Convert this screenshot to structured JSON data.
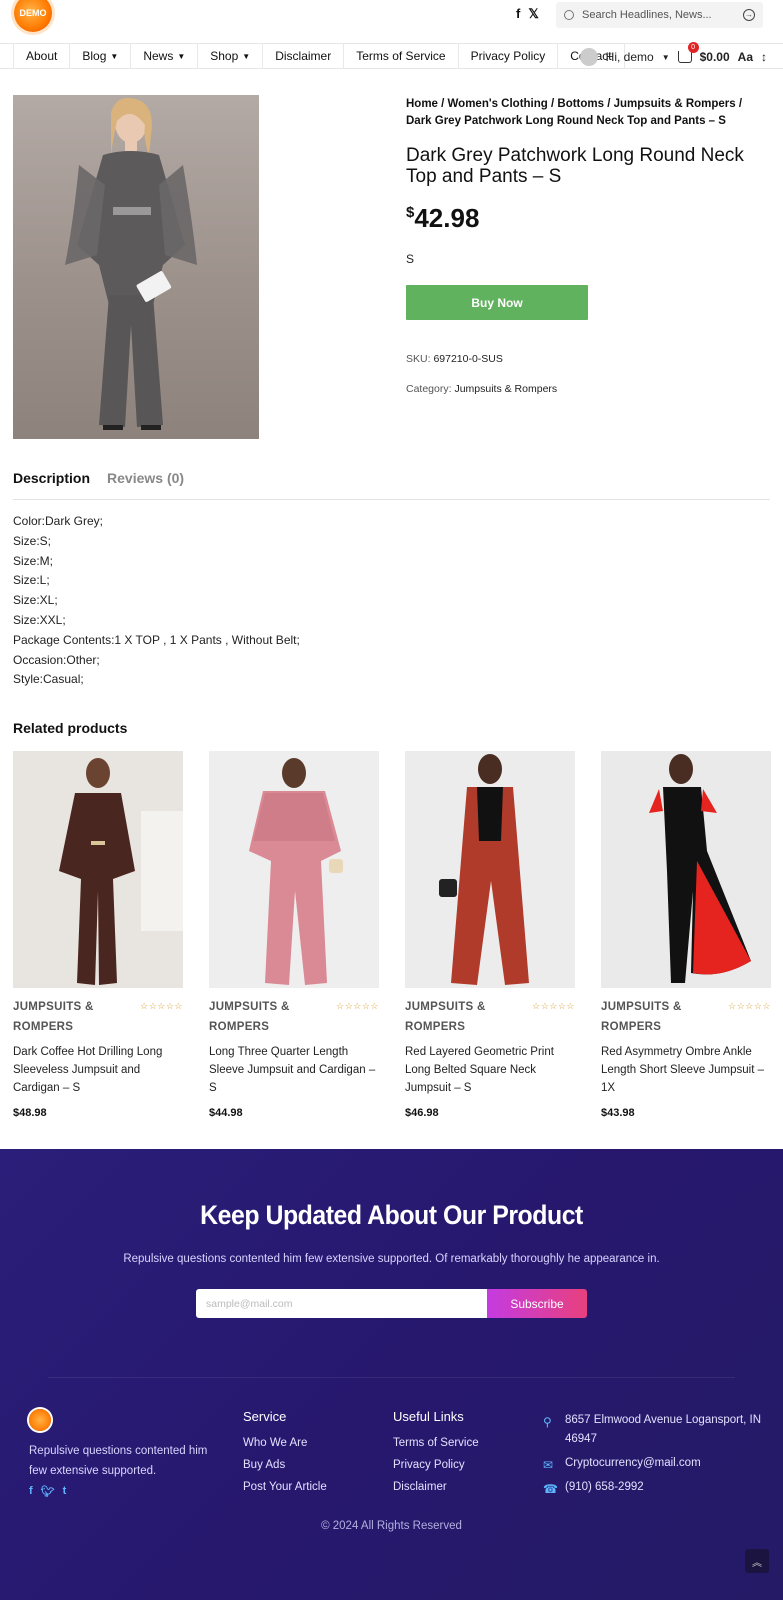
{
  "header": {
    "logo_text": "DEMO",
    "search_placeholder": "Search Headlines, News...",
    "social": [
      "f",
      "𝕏"
    ]
  },
  "nav": {
    "items": [
      {
        "label": "About",
        "has_dropdown": false
      },
      {
        "label": "Blog",
        "has_dropdown": true
      },
      {
        "label": "News",
        "has_dropdown": true
      },
      {
        "label": "Shop",
        "has_dropdown": true
      },
      {
        "label": "Disclaimer",
        "has_dropdown": false
      },
      {
        "label": "Terms of Service",
        "has_dropdown": false
      },
      {
        "label": "Privacy Policy",
        "has_dropdown": false
      },
      {
        "label": "Contact",
        "has_dropdown": false
      }
    ],
    "greeting": "Hi, demo",
    "cart_count": "0",
    "cart_total": "$0.00",
    "font_toggle": "Aa"
  },
  "product": {
    "breadcrumb": "Home / Women's Clothing / Bottoms / Jumpsuits & Rompers / Dark Grey Patchwork Long Round Neck Top and Pants – S",
    "title": "Dark Grey Patchwork Long Round Neck Top and Pants – S",
    "price_symbol": "$",
    "price_value": "42.98",
    "size": "S",
    "buy_label": "Buy Now",
    "sku_label": "SKU:",
    "sku_value": "697210-0-SUS",
    "category_label": "Category:",
    "category_value": "Jumpsuits & Rompers"
  },
  "tabs": {
    "description": "Description",
    "reviews": "Reviews (0)"
  },
  "description_lines": [
    "Color:Dark Grey;",
    "Size:S;",
    "Size:M;",
    "Size:L;",
    "Size:XL;",
    "Size:XXL;",
    "Package Contents:1 X TOP , 1 X Pants , Without Belt;",
    "Occasion:Other;",
    "Style:Casual;"
  ],
  "related": {
    "title": "Related products",
    "items": [
      {
        "category": "JUMPSUITS & ROMPERS",
        "name": "Dark Coffee Hot Drilling Long Sleeveless Jumpsuit and Cardigan – S",
        "price": "$48.98",
        "stars": "☆☆☆☆☆",
        "colors": {
          "outfit": "#4a2620",
          "bg": "#e8e4df"
        }
      },
      {
        "category": "JUMPSUITS & ROMPERS",
        "name": "Long Three Quarter Length Sleeve Jumpsuit and Cardigan – S",
        "price": "$44.98",
        "stars": "☆☆☆☆☆",
        "colors": {
          "outfit": "#d98a95",
          "bg": "#efeeee"
        }
      },
      {
        "category": "JUMPSUITS & ROMPERS",
        "name": "Red Layered Geometric Print Long Belted Square Neck Jumpsuit – S",
        "price": "$46.98",
        "stars": "☆☆☆☆☆",
        "colors": {
          "outfit": "#b13b2a",
          "bg": "#ececec"
        }
      },
      {
        "category": "JUMPSUITS & ROMPERS",
        "name": "Red Asymmetry Ombre Ankle Length Short Sleeve Jumpsuit – 1X",
        "price": "$43.98",
        "stars": "☆☆☆☆☆",
        "colors": {
          "outfit": "#e5241f",
          "bg": "#eaeaea"
        }
      }
    ]
  },
  "newsletter": {
    "title": "Keep Updated About Our Product",
    "subtitle": "Repulsive questions contented him few extensive supported. Of remarkably thoroughly he appearance in.",
    "placeholder": "sample@mail.com",
    "button": "Subscribe"
  },
  "footer": {
    "about": "Repulsive questions contented him few extensive supported.",
    "social": [
      "f",
      "t",
      "t"
    ],
    "service_title": "Service",
    "service_links": [
      "Who We Are",
      "Buy Ads",
      "Post Your Article"
    ],
    "useful_title": "Useful Links",
    "useful_links": [
      "Terms of Service",
      "Privacy Policy",
      "Disclaimer"
    ],
    "address": "8657 Elmwood Avenue Logansport, IN 46947",
    "email": "Cryptocurrency@mail.com",
    "phone": "(910) 658-2992",
    "copyright": "© 2024 All Rights Reserved"
  }
}
